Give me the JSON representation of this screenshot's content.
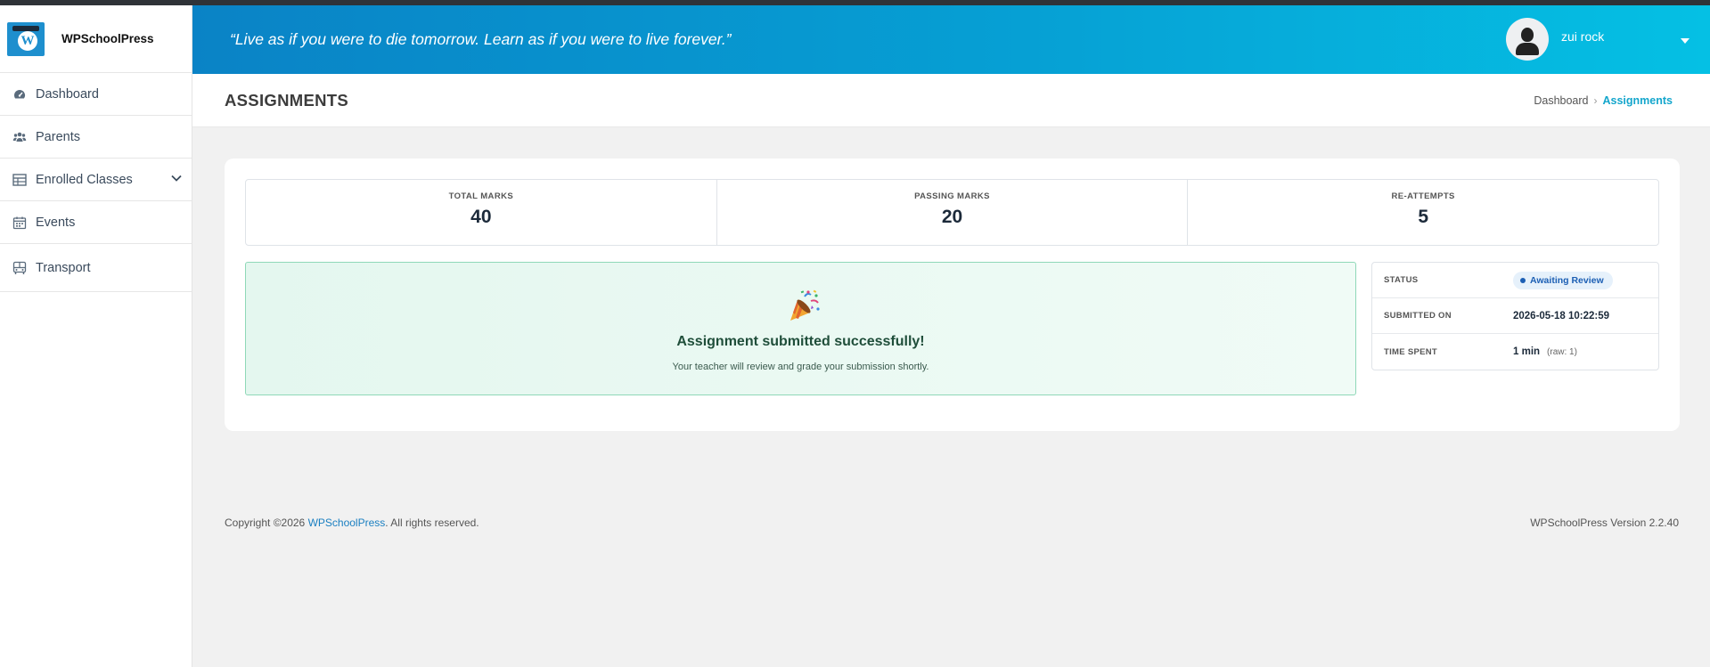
{
  "brand": {
    "name": "WPSchoolPress"
  },
  "sidebar": {
    "items": [
      {
        "label": "Dashboard",
        "icon": "dashboard-icon"
      },
      {
        "label": "Parents",
        "icon": "users-icon"
      },
      {
        "label": "Enrolled Classes",
        "icon": "table-icon",
        "expandable": true
      },
      {
        "label": "Events",
        "icon": "calendar-icon"
      },
      {
        "label": "Transport",
        "icon": "bus-icon"
      }
    ]
  },
  "header": {
    "quote": "“Live as if you were to die tomorrow. Learn as if you were to live forever.”",
    "user_name": "zui rock"
  },
  "page": {
    "title": "ASSIGNMENTS",
    "breadcrumb": {
      "home": "Dashboard",
      "current": "Assignments"
    }
  },
  "stats": {
    "total_marks_label": "TOTAL MARKS",
    "total_marks": "40",
    "passing_marks_label": "PASSING MARKS",
    "passing_marks": "20",
    "reattempts_label": "RE-ATTEMPTS",
    "reattempts": "5"
  },
  "success": {
    "icon": "party-popper-icon",
    "title": "Assignment submitted successfully!",
    "subtitle": "Your teacher will review and grade your submission shortly."
  },
  "details": {
    "status_label": "STATUS",
    "status_value": "Awaiting Review",
    "submitted_label": "SUBMITTED ON",
    "submitted_value": "2026-05-18 10:22:59",
    "time_label": "TIME SPENT",
    "time_value": "1 min",
    "time_raw": "(raw: 1)"
  },
  "footer": {
    "copyright_prefix": "Copyright ©2026 ",
    "copyright_link": "WPSchoolPress",
    "copyright_suffix": ". All rights reserved.",
    "version": "WPSchoolPress Version 2.2.40"
  },
  "colors": {
    "header_start": "#0a83c6",
    "header_end": "#05c0e4",
    "accent": "#14a6cc",
    "success_border": "#8fd8b8",
    "badge_text": "#1c5fb4"
  }
}
